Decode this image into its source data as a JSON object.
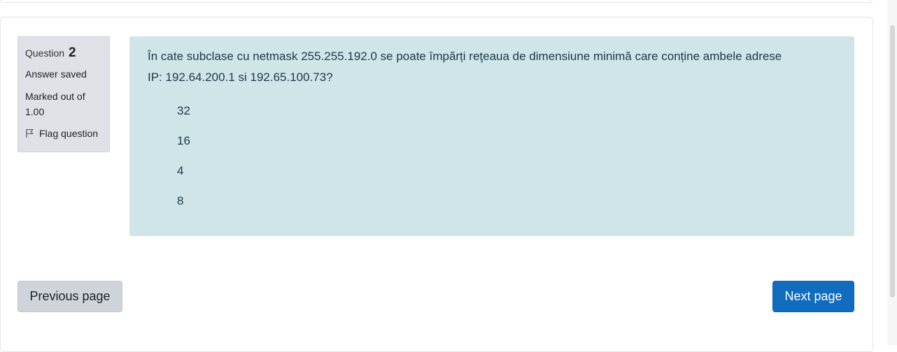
{
  "question_info": {
    "question_label": "Question",
    "question_number": "2",
    "state": "Answer saved",
    "marked_line1": "Marked out of",
    "marked_line2": "1.00",
    "flag_label": "Flag question"
  },
  "question": {
    "text_line1": "În cate subclase cu netmask 255.255.192.0 se poate împărți reţeaua de dimensiune minimă care conține ambele adrese",
    "text_line2": "IP: 192.64.200.1 si 192.65.100.73?",
    "answers": [
      "32",
      "16",
      "4",
      "8"
    ]
  },
  "navigation": {
    "previous_label": "Previous page",
    "next_label": "Next page"
  },
  "colors": {
    "question_bg": "#cfe5e8",
    "info_bg": "#dee2e6",
    "next_button": "#0f6cbf",
    "prev_button": "#ced4da"
  }
}
